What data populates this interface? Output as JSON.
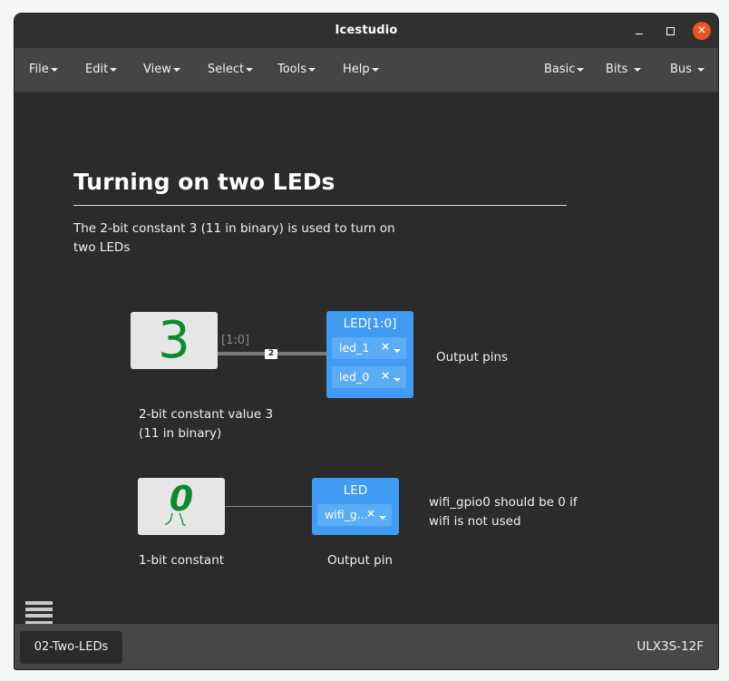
{
  "window": {
    "title": "Icestudio",
    "minimize_label": "",
    "maximize_label": "",
    "close_label": "×"
  },
  "menubar": {
    "left": [
      {
        "label": "File"
      },
      {
        "label": "Edit"
      },
      {
        "label": "View"
      },
      {
        "label": "Select"
      },
      {
        "label": "Tools"
      },
      {
        "label": "Help"
      }
    ],
    "right": [
      {
        "label": "Basic"
      },
      {
        "label": "Bits"
      },
      {
        "label": "Bus"
      }
    ]
  },
  "canvas": {
    "heading": "Turning on two LEDs",
    "description": "The 2-bit constant 3 (11 in binary) is used to turn on two LEDs",
    "circuit1": {
      "constant_value": "3",
      "constant_label_line1": "2-bit constant value 3",
      "constant_label_line2": "(11 in binary)",
      "bus_label": "[1:0]",
      "bus_width": "2",
      "output_title": "LED[1:0]",
      "pins": [
        {
          "name": "led_1",
          "clear": "×"
        },
        {
          "name": "led_0",
          "clear": "×"
        }
      ],
      "output_note": "Output pins"
    },
    "circuit2": {
      "constant_value": "0",
      "constant_label": "1-bit constant",
      "output_title": "LED",
      "pin": {
        "name": "wifi_g...",
        "clear": "×"
      },
      "output_label": "Output pin",
      "note": "wifi_gpio0 should be 0 if wifi is not used"
    }
  },
  "statusbar": {
    "file_tab": "02-Two-LEDs",
    "board": "ULX3S-12F"
  },
  "colors": {
    "titlebar": "#303030",
    "menubar": "#454545",
    "canvas": "#2b2b2b",
    "constant_text": "#0e8a2e",
    "output_block": "#3f9cf2",
    "close_button": "#e95420"
  }
}
